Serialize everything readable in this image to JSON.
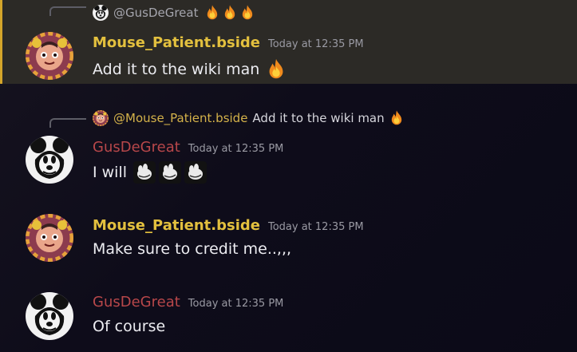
{
  "colors": {
    "mouse_name": "#e3c03e",
    "gus_name": "#b8474a",
    "highlight_bg": "#2c2a26",
    "highlight_bar": "#d4a52a",
    "timestamp": "#9a9aa3"
  },
  "messages": [
    {
      "reply": {
        "author": "@GusDeGreat",
        "text": "",
        "emojis": [
          "fire-icon",
          "fire-icon",
          "fire-icon"
        ]
      },
      "author": "Mouse_Patient.bside",
      "timestamp": "Today at 12:35 PM",
      "text": "Add it to the wiki man",
      "emoji": "fire-icon",
      "highlighted": true
    },
    {
      "reply": {
        "author": "@Mouse_Patient.bside",
        "text": "Add it to the wiki man",
        "emojis": [
          "fire-icon"
        ]
      },
      "author": "GusDeGreat",
      "timestamp": "Today at 12:35 PM",
      "text": "I will",
      "stickers": [
        "cartoon-hand-icon",
        "cartoon-hand-icon",
        "cartoon-hand-icon"
      ]
    },
    {
      "author": "Mouse_Patient.bside",
      "timestamp": "Today at 12:35 PM",
      "text": "Make sure to credit me..,,,"
    },
    {
      "author": "GusDeGreat",
      "timestamp": "Today at 12:35 PM",
      "text": "Of course"
    }
  ]
}
